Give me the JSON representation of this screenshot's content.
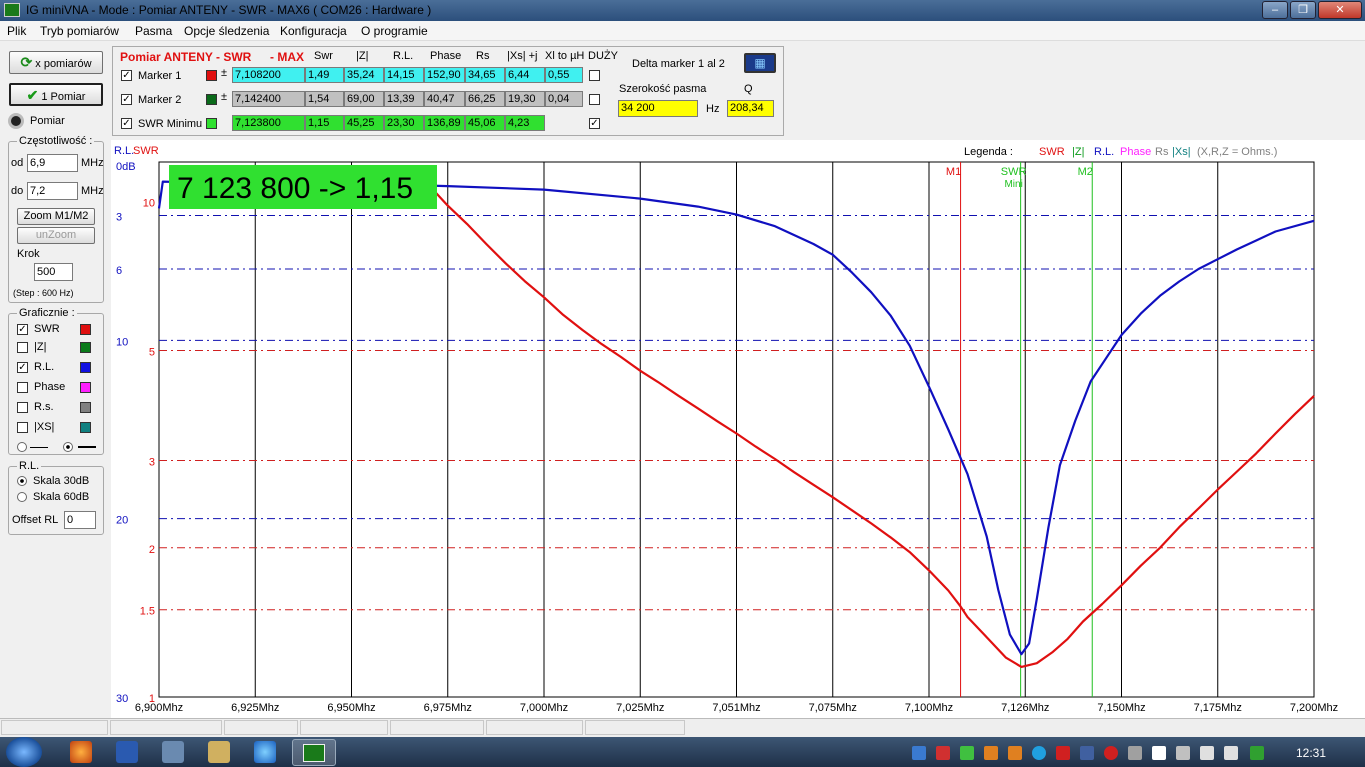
{
  "window": {
    "title": "IG miniVNA - Mode : Pomiar ANTENY - SWR     - MAX6 ( COM26 :  Hardware )"
  },
  "menu": [
    "Plik",
    "Tryb pomiarów",
    "Pasma",
    "Opcje śledzenia",
    "Konfiguracja",
    "O programie"
  ],
  "left": {
    "x_pomiarow": "x pomiarów",
    "jeden_pomiar": "1 Pomiar",
    "pomiar": "Pomiar",
    "czest_title": "Częstotliwość :",
    "od_label": "od",
    "od_value": "6,9",
    "od_unit": "MHz",
    "do_label": "do",
    "do_value": "7,2",
    "do_unit": "MHz",
    "zoom": "Zoom M1/M2",
    "unzoom": "unZoom",
    "krok_label": "Krok",
    "krok_value": "500",
    "step_note": "(Step : 600 Hz)",
    "graf_title": "Graficznie :",
    "graf_items": [
      {
        "label": "SWR",
        "checked": "✓",
        "color": "#e01010"
      },
      {
        "label": "|Z|",
        "checked": "",
        "color": "#0a7a1a"
      },
      {
        "label": "R.L.",
        "checked": "✓",
        "color": "#1010e0"
      },
      {
        "label": "Phase",
        "checked": "",
        "color": "#ff20ff"
      },
      {
        "label": "R.s.",
        "checked": "",
        "color": "#808080"
      },
      {
        "label": "|XS|",
        "checked": "",
        "color": "#108080"
      }
    ],
    "rl_title": "R.L.",
    "skala30": "Skala 30dB",
    "skala60": "Skala 60dB",
    "offset_label": "Offset RL",
    "offset_value": "0"
  },
  "markers": {
    "title": "Pomiar ANTENY - SWR",
    "max": "- MAX",
    "headers": [
      "Swr",
      "|Z|",
      "R.L.",
      "Phase",
      "Rs",
      "|Xs| +j",
      "Xl to µH",
      "DUŻY"
    ],
    "rows": [
      {
        "label": "Marker 1",
        "checked": "✓",
        "color": "#e01010",
        "pm": "±",
        "values": [
          "7,108200",
          "1,49",
          "35,24",
          "14,15",
          "152,90",
          "34,65",
          "6,44",
          "0,55"
        ],
        "bg": "#40f0f0",
        "big": ""
      },
      {
        "label": "Marker 2",
        "checked": "✓",
        "color": "#0a6a1a",
        "pm": "±",
        "values": [
          "7,142400",
          "1,54",
          "69,00",
          "13,39",
          "40,47",
          "66,25",
          "19,30",
          "0,04"
        ],
        "bg": "#c0c0c0",
        "big": ""
      },
      {
        "label": "SWR Minimu",
        "checked": "✓",
        "color": "#30e030",
        "pm": "",
        "values": [
          "7,123800",
          "1,15",
          "45,25",
          "23,30",
          "136,89",
          "45,06",
          "4,23"
        ],
        "bg": "#30e030",
        "big": "✓"
      }
    ],
    "delta": "Delta marker 1 al 2",
    "bandwidth_label": "Szerokość pasma",
    "bandwidth_value": "34 200",
    "hz": "Hz",
    "q_label": "Q",
    "q_value": "208,34"
  },
  "chart_data": {
    "type": "line",
    "x_unit": "Mhz",
    "xlim": [
      6.9,
      7.2
    ],
    "x_ticks": [
      "6,900Mhz",
      "6,925Mhz",
      "6,950Mhz",
      "6,975Mhz",
      "7,000Mhz",
      "7,025Mhz",
      "7,051Mhz",
      "7,075Mhz",
      "7,100Mhz",
      "7,126Mhz",
      "7,150Mhz",
      "7,175Mhz",
      "7,200Mhz"
    ],
    "swr_axis_label": "SWR",
    "swr_ticks": [
      {
        "label": "10",
        "v": 10
      },
      {
        "label": "5",
        "v": 5
      },
      {
        "label": "3",
        "v": 3
      },
      {
        "label": "2",
        "v": 2
      },
      {
        "label": "1.5",
        "v": 1.5
      },
      {
        "label": "1",
        "v": 1
      }
    ],
    "rl_axis_label": "R.L.",
    "rl_unit": "0dB",
    "rl_ticks": [
      {
        "label": "3",
        "v": 3
      },
      {
        "label": "6",
        "v": 6
      },
      {
        "label": "10",
        "v": 10
      },
      {
        "label": "20",
        "v": 20
      },
      {
        "label": "30",
        "v": 30
      }
    ],
    "legend": {
      "title": "Legenda :",
      "items": [
        {
          "label": "SWR",
          "color": "#e01010"
        },
        {
          "label": "|Z|",
          "color": "#0a9a1a"
        },
        {
          "label": "R.L.",
          "color": "#1010c0"
        },
        {
          "label": "Phase",
          "color": "#ff20ff"
        },
        {
          "label": "Rs",
          "color": "#808080"
        },
        {
          "label": "|Xs|",
          "color": "#108080"
        },
        {
          "label": "(X,R,Z = Ohms.)",
          "color": "#808080"
        }
      ]
    },
    "markers": [
      {
        "label": "M1",
        "x": 7.1082,
        "color": "#e01010"
      },
      {
        "label": "SWR",
        "sub": "Mini",
        "x": 7.1238,
        "color": "#20c020"
      },
      {
        "label": "M2",
        "x": 7.1424,
        "color": "#20c020"
      }
    ],
    "readout": "7 123 800 -> 1,15",
    "series": [
      {
        "name": "SWR",
        "color": "#e01010",
        "axis": "swr",
        "x": [
          6.97,
          6.975,
          6.98,
          6.985,
          6.99,
          6.995,
          7.0,
          7.005,
          7.01,
          7.015,
          7.02,
          7.025,
          7.03,
          7.035,
          7.04,
          7.045,
          7.05,
          7.055,
          7.06,
          7.065,
          7.07,
          7.075,
          7.08,
          7.085,
          7.09,
          7.095,
          7.1,
          7.105,
          7.108,
          7.11,
          7.115,
          7.12,
          7.124,
          7.128,
          7.132,
          7.136,
          7.14,
          7.145,
          7.15,
          7.155,
          7.16,
          7.165,
          7.17,
          7.175,
          7.18,
          7.185,
          7.19,
          7.195,
          7.2
        ],
        "y": [
          10.8,
          9.8,
          9.0,
          8.2,
          7.5,
          6.9,
          6.4,
          5.9,
          5.5,
          5.15,
          4.85,
          4.55,
          4.3,
          4.05,
          3.82,
          3.6,
          3.4,
          3.2,
          3.02,
          2.84,
          2.68,
          2.53,
          2.38,
          2.24,
          2.1,
          1.96,
          1.8,
          1.64,
          1.53,
          1.45,
          1.32,
          1.2,
          1.15,
          1.17,
          1.23,
          1.31,
          1.42,
          1.54,
          1.68,
          1.84,
          2.0,
          2.2,
          2.4,
          2.62,
          2.85,
          3.1,
          3.4,
          3.72,
          4.05
        ]
      },
      {
        "name": "R.L.",
        "color": "#1010c0",
        "axis": "rl",
        "x": [
          6.9,
          6.901,
          6.905,
          6.925,
          6.95,
          6.975,
          7.0,
          7.025,
          7.04,
          7.05,
          7.06,
          7.07,
          7.075,
          7.08,
          7.085,
          7.09,
          7.095,
          7.1,
          7.105,
          7.11,
          7.115,
          7.118,
          7.121,
          7.124,
          7.126,
          7.128,
          7.131,
          7.134,
          7.138,
          7.142,
          7.146,
          7.15,
          7.155,
          7.16,
          7.165,
          7.17,
          7.175,
          7.18,
          7.185,
          7.19,
          7.2
        ],
        "y": [
          2.6,
          1.1,
          1.12,
          1.15,
          1.2,
          1.35,
          1.55,
          2.05,
          2.5,
          2.95,
          3.6,
          4.6,
          5.2,
          6.2,
          7.3,
          8.6,
          10.3,
          12.6,
          15.0,
          17.5,
          21.0,
          24.0,
          26.5,
          27.6,
          27.0,
          24.5,
          20.5,
          17.0,
          14.5,
          12.3,
          11.0,
          9.7,
          8.5,
          7.5,
          6.7,
          6.0,
          5.45,
          4.9,
          4.4,
          3.9,
          3.3
        ]
      }
    ]
  },
  "taskbar": {
    "time": "12:31"
  }
}
